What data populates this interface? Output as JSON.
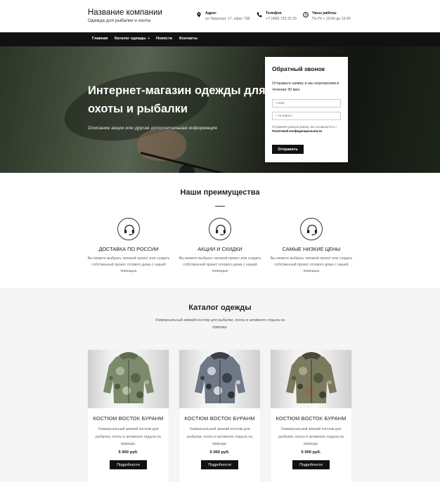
{
  "header": {
    "company_name": "Название компании",
    "tagline": "Одежда для рыбалки и охоты",
    "address_label": "Адрес",
    "address_value": "ул Тверская, 17, офис 738",
    "phone_label": "Телефон",
    "phone_value": "+7 (495) 725 25 25",
    "hours_label": "Часы работы",
    "hours_value": "Пн-Пт с 10:00 до 19:00"
  },
  "nav": {
    "items": [
      "Главная",
      "Каталог одежды",
      "Новости",
      "Контакты"
    ]
  },
  "hero": {
    "title": "Интернет-магазин одежды для охоты и рыбалки",
    "subtitle": "Описание акции или другая дополнительная информация"
  },
  "callback": {
    "title": "Обратный звонок",
    "text": "Отправьте заявку и мы перезвоним в течении 30 мин",
    "name_placeholder": "• Имя:",
    "phone_placeholder": "• Телефон:",
    "consent_text": "Отправляя данную форму, вы соглашаетесь с",
    "consent_link": "Политикой конфиденциальности",
    "button": "Отправить"
  },
  "advantages": {
    "title": "Наши преимущества",
    "items": [
      {
        "name": "ДОСТАВКА ПО РОССИИ",
        "desc": "Вы можете выбрать типовой проект или создать собственный проект готового дома с нашей помощью",
        "icon": "headset-icon"
      },
      {
        "name": "АКЦИИ И СКИДКИ",
        "desc": "Вы можете выбрать типовой проект или создать собственный проект готового дома с нашей помощью",
        "icon": "headset-icon"
      },
      {
        "name": "САМЫЕ НИЗКИЕ ЦЕНЫ",
        "desc": "Вы можете выбрать типовой проект или создать собственный проект готового дома с нашей помощью",
        "icon": "headset-icon"
      }
    ]
  },
  "catalog": {
    "title": "Каталог одежды",
    "description": "Универсальный зимний костюм для рыбалки, охоты и активного отдыха на природе.",
    "products": [
      {
        "name": "КОСТЮМ ВОСТОК БУРАНМ",
        "desc": "Универсальный зимний костюм для рыбалки, охоты и активного отдыха на природе.",
        "price": "5 000 руб.",
        "button": "Подробности",
        "camo": "#8a9a76"
      },
      {
        "name": "КОСТЮМ ВОСТОК БУРАНМ",
        "desc": "Универсальный зимний костюм для рыбалки, охоты и активного отдыха на природе.",
        "price": "5 000 руб.",
        "button": "Подробности",
        "camo": "#7c8796"
      },
      {
        "name": "КОСТЮМ ВОСТОК БУРАНМ",
        "desc": "Универсальный зимний костюм для рыбалки, охоты и активного отдыха на природе.",
        "price": "5 000 руб.",
        "button": "Подробности",
        "camo": "#7f7f63"
      }
    ]
  },
  "colors": {
    "dark": "#111111",
    "catalog_bg": "#f5f5f5"
  }
}
